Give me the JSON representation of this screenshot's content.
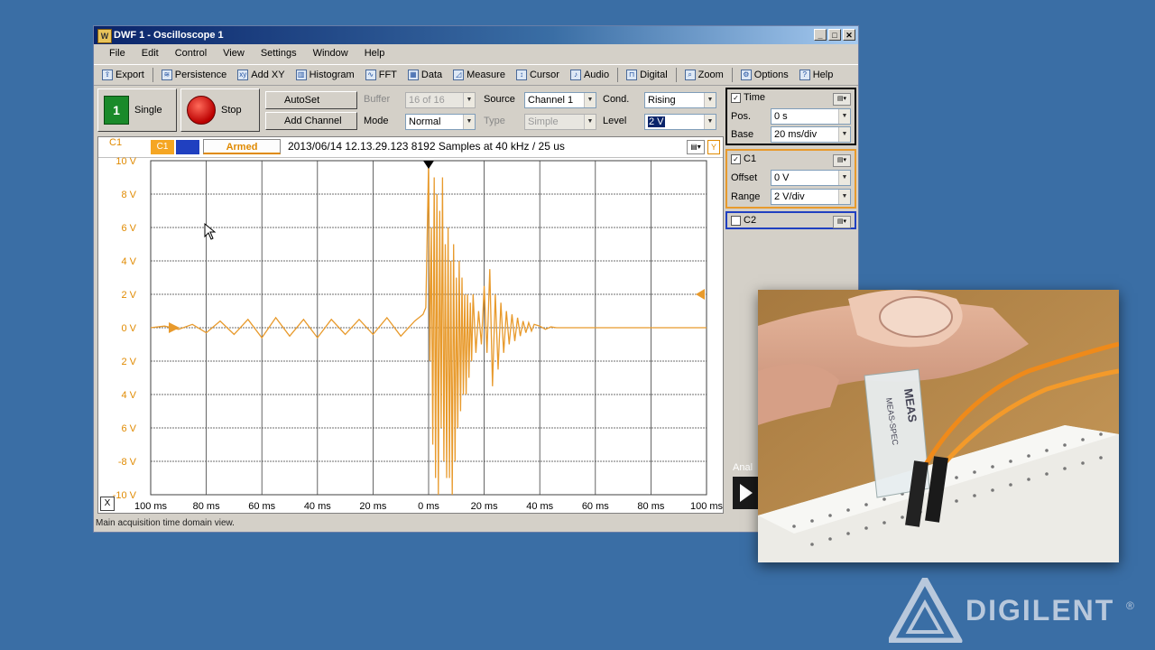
{
  "window": {
    "title": "DWF 1 - Oscilloscope 1",
    "icon_label": "W",
    "controls": [
      "_",
      "□",
      "✕"
    ]
  },
  "menu": [
    "File",
    "Edit",
    "Control",
    "View",
    "Settings",
    "Window",
    "Help"
  ],
  "toolbar": [
    {
      "label": "Export",
      "icon": "export-icon"
    },
    {
      "label": "Persistence",
      "icon": "persistence-icon"
    },
    {
      "label": "Add XY",
      "icon": "xy-icon"
    },
    {
      "label": "Histogram",
      "icon": "histogram-icon"
    },
    {
      "label": "FFT",
      "icon": "fft-icon"
    },
    {
      "label": "Data",
      "icon": "data-icon"
    },
    {
      "label": "Measure",
      "icon": "measure-icon"
    },
    {
      "label": "Cursor",
      "icon": "cursor-icon"
    },
    {
      "label": "Audio",
      "icon": "audio-icon"
    },
    {
      "label": "Digital",
      "icon": "digital-icon"
    },
    {
      "label": "Zoom",
      "icon": "zoom-icon"
    },
    {
      "label": "Options",
      "icon": "options-icon"
    },
    {
      "label": "Help",
      "icon": "help-icon"
    }
  ],
  "controls": {
    "single_label": "Single",
    "stop_label": "Stop",
    "autoset_label": "AutoSet",
    "add_channel_label": "Add Channel",
    "buffer_label": "Buffer",
    "buffer_value": "16 of 16",
    "mode_label": "Mode",
    "mode_value": "Normal",
    "source_label": "Source",
    "source_value": "Channel 1",
    "type_label": "Type",
    "type_value": "Simple",
    "cond_label": "Cond.",
    "cond_value": "Rising",
    "level_label": "Level",
    "level_value": "2 V"
  },
  "plot": {
    "channel_corner": "C1",
    "c1_badge": "C1",
    "state": "Armed",
    "info": "2013/06/14  12.13.29.123   8192 Samples at 40 kHz / 25 us",
    "y_button": "Y",
    "x_button": "X"
  },
  "chart_data": {
    "type": "line",
    "title": "",
    "xlabel": "",
    "ylabel": "",
    "x_ticks": [
      "100 ms",
      "80 ms",
      "60 ms",
      "40 ms",
      "20 ms",
      "0 ms",
      "20 ms",
      "40 ms",
      "60 ms",
      "80 ms",
      "100 ms"
    ],
    "y_ticks": [
      "10 V",
      "8 V",
      "6 V",
      "4 V",
      "2 V",
      "0 V",
      "2 V",
      "4 V",
      "6 V",
      "-8 V",
      "-10 V"
    ],
    "xlim": [
      -100,
      100
    ],
    "ylim": [
      -10,
      10
    ],
    "grid": true,
    "trigger_level": 2,
    "series": [
      {
        "name": "C1",
        "color": "#e89a2c",
        "x": [
          -100,
          -95,
          -90,
          -85,
          -80,
          -75,
          -70,
          -65,
          -60,
          -55,
          -50,
          -45,
          -40,
          -35,
          -30,
          -25,
          -20,
          -15,
          -10,
          -5,
          -2,
          -1,
          0,
          0.5,
          1,
          1.5,
          2,
          2.5,
          3,
          3.5,
          4,
          4.5,
          5,
          5.5,
          6,
          6.5,
          7,
          7.5,
          8,
          8.5,
          9,
          9.5,
          10,
          10.5,
          11,
          11.5,
          12,
          12.5,
          13,
          13.5,
          14,
          14.5,
          15,
          15.5,
          16,
          17,
          18,
          19,
          20,
          21,
          22,
          23,
          24,
          25,
          26,
          27,
          28,
          29,
          30,
          31,
          32,
          33,
          34,
          35,
          36,
          37,
          38,
          40,
          42,
          44,
          46,
          48,
          50,
          55,
          60,
          70,
          80,
          90,
          100
        ],
        "y": [
          0,
          0.1,
          -0.1,
          0.2,
          -0.3,
          0.4,
          -0.4,
          0.5,
          -0.6,
          0.6,
          -0.5,
          0.5,
          -0.6,
          0.5,
          -0.4,
          0.5,
          -0.4,
          0.6,
          -0.5,
          0.4,
          0.8,
          1.2,
          10,
          -2,
          6,
          -7,
          9,
          -9,
          8,
          -10,
          7,
          -6,
          9,
          -8,
          5,
          -9,
          6,
          -9,
          4,
          -10,
          5,
          -8,
          3,
          -6,
          4,
          -5,
          3,
          -4,
          2,
          -4,
          2,
          -3,
          1.5,
          -2,
          2,
          -1.5,
          1,
          -1,
          2.5,
          -1.5,
          3.5,
          -3.5,
          2,
          -2.5,
          1.5,
          -1.5,
          1,
          -1,
          0.8,
          -0.8,
          0.6,
          -0.5,
          0.4,
          -0.3,
          0.3,
          -0.2,
          0.2,
          0.1,
          -0.1,
          0.05,
          0,
          0,
          0,
          0,
          0,
          0,
          0,
          0,
          0
        ]
      }
    ]
  },
  "time_panel": {
    "title": "Time",
    "pos_label": "Pos.",
    "pos_value": "0 s",
    "base_label": "Base",
    "base_value": "20 ms/div"
  },
  "c1_panel": {
    "title": "C1",
    "offset_label": "Offset",
    "offset_value": "0 V",
    "range_label": "Range",
    "range_value": "2 V/div"
  },
  "c2_panel": {
    "title": "C2"
  },
  "status": "Main acquisition time domain view.",
  "photo": {
    "sensor_text_1": "MEAS",
    "sensor_text_2": "MEAS-SPEC"
  },
  "side": {
    "analyzer_label": "Anal"
  },
  "brand": {
    "name": "DIGILENT",
    "reg": "®"
  },
  "colors": {
    "accent": "#e89a2c",
    "grid": "#404040",
    "c2": "#2040c0",
    "desktop": "#3a6ea5"
  }
}
